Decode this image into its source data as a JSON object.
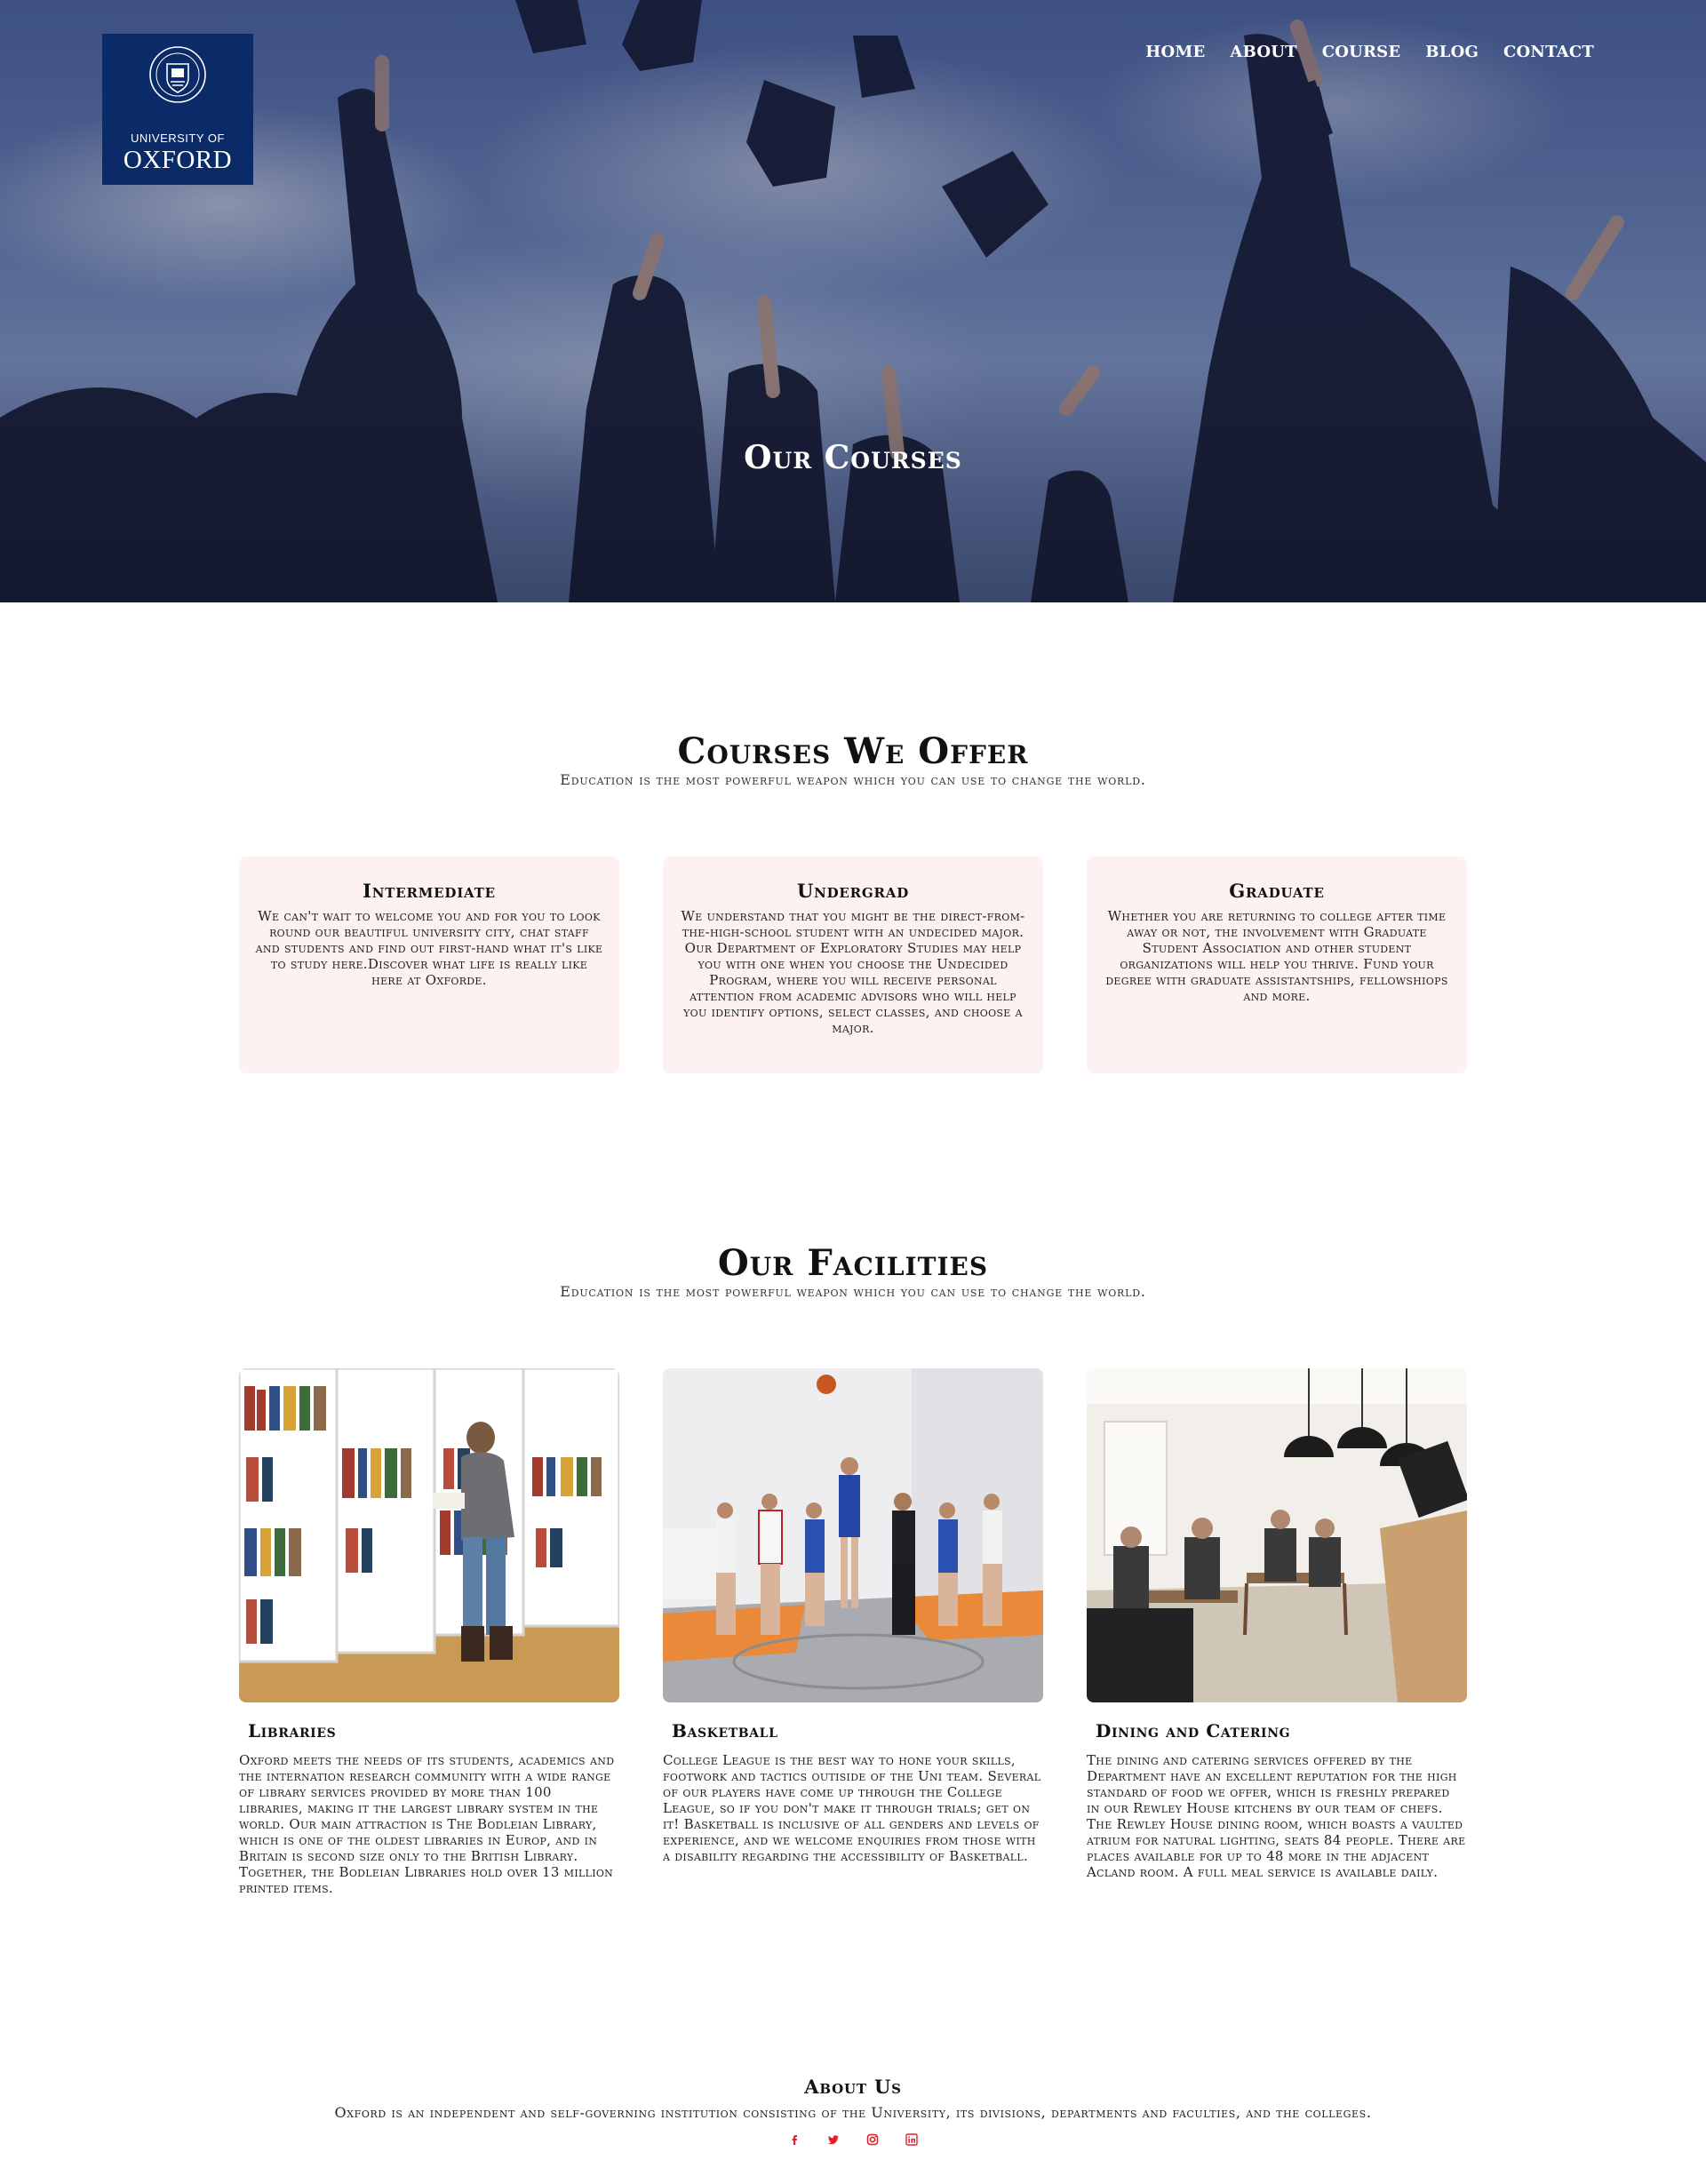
{
  "logo": {
    "line1": "UNIVERSITY OF",
    "line2": "OXFORD"
  },
  "nav": {
    "items": [
      "HOME",
      "ABOUT",
      "COURSE",
      "BLOG",
      "CONTACT"
    ]
  },
  "hero": {
    "title": "Our Courses"
  },
  "courses": {
    "title": "Courses We Offer",
    "subtitle": "Education is the most powerful weapon which you can use to change the world.",
    "cards": [
      {
        "title": "Intermediate",
        "text": "We can't wait to welcome you and for you to look round our beautiful university city, chat staff and students and find out first-hand what it's like to study here.Discover what life is really like here at Oxforde."
      },
      {
        "title": "Undergrad",
        "text": "We understand that you might be the direct-from-the-high-school student with an undecided major. Our Department of Exploratory Studies may help you with one when you choose the Undecided Program, where you will receive personal attention from academic advisors who will help you identify options, select classes, and choose a major."
      },
      {
        "title": "Graduate",
        "text": "Whether you are returning to college after time away or not, the involvement with Graduate Student Association and other student organizations will help you thrive. Fund your degree with graduate assistantships, fellowshiops and more."
      }
    ]
  },
  "facilities": {
    "title": "Our Facilities",
    "subtitle": "Education is the most powerful weapon which you can use to change the world.",
    "items": [
      {
        "title": "Libraries",
        "text": "Oxford meets the needs of its students, academics and the internation research community with a wide range of library services provided by more than 100 libraries, making it the largest library system in the world. Our main attraction is The Bodleian Library, which is one of the oldest libraries in Europ, and in Britain is second size only to the British Library. Together, the Bodleian Libraries hold over 13 million printed items."
      },
      {
        "title": "Basketball",
        "text": "College League is the best way to hone your skills, footwork and tactics outiside of the Uni team. Several of our players have come up through the College League, so if you don't make it through trials; get on it! Basketball is inclusive of all genders and levels of experience, and we welcome enquiries from those with a disability regarding the accessibility of Basketball."
      },
      {
        "title": "Dining and Catering",
        "text": "The dining and catering services offered by the Department have an excellent reputation for the high standard of food we offer, which is freshly prepared in our Rewley House kitchens by our team of chefs. The Rewley House dining room, which boasts a vaulted atrium for natural lighting, seats 84 people. There are places available for up to 48 more in the adjacent Acland room. A full meal service is available daily."
      }
    ]
  },
  "footer": {
    "title": "About Us",
    "text": "Oxford is an independent and self-governing institution consisting of the University, its divisions, departments and faculties, and the colleges.",
    "social": [
      "facebook-icon",
      "twitter-icon",
      "instagram-icon",
      "linkedin-icon"
    ]
  },
  "colors": {
    "brand": "#0b2a68",
    "card_bg": "#fdf1f1",
    "social": "#e0202a"
  }
}
